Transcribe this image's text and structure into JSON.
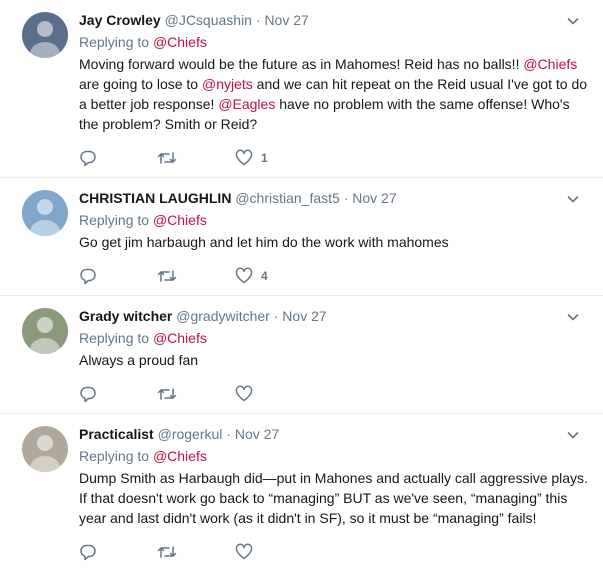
{
  "tweets": [
    {
      "name": "Jay Crowley",
      "handle": "@JCsquashin",
      "sep": "·",
      "time": "Nov 27",
      "replying_prefix": "Replying to ",
      "replying_to": "@Chiefs",
      "segments": [
        {
          "t": "Moving forward would be the future as in Mahomes! Reid has no balls!! ",
          "link": false
        },
        {
          "t": "@Chiefs",
          "link": true
        },
        {
          "t": " are going to lose to ",
          "link": false
        },
        {
          "t": "@nyjets",
          "link": true
        },
        {
          "t": " and we can hit repeat on the Reid usual I've got to do a better job response! ",
          "link": false
        },
        {
          "t": "@Eagles",
          "link": true
        },
        {
          "t": " have no problem with the same offense! Who's the problem? Smith or Reid?",
          "link": false
        }
      ],
      "likes": "1",
      "avatar_color": "#5a6f8a"
    },
    {
      "name": "CHRISTIAN LAUGHLIN",
      "handle": "@christian_fast5",
      "sep": "·",
      "time": "Nov 27",
      "replying_prefix": "Replying to ",
      "replying_to": "@Chiefs",
      "segments": [
        {
          "t": "Go get jim harbaugh and let him do the work with mahomes",
          "link": false
        }
      ],
      "likes": "4",
      "avatar_color": "#7fa7c9"
    },
    {
      "name": "Grady witcher",
      "handle": "@gradywitcher",
      "sep": "·",
      "time": "Nov 27",
      "replying_prefix": "Replying to ",
      "replying_to": "@Chiefs",
      "segments": [
        {
          "t": "Always a proud fan",
          "link": false
        }
      ],
      "likes": "",
      "avatar_color": "#8a9a7a"
    },
    {
      "name": "Practicalist",
      "handle": "@rogerkul",
      "sep": "·",
      "time": "Nov 27",
      "replying_prefix": "Replying to ",
      "replying_to": "@Chiefs",
      "segments": [
        {
          "t": "Dump Smith as Harbaugh did—put in Mahones and actually call aggressive plays. If that doesn't work go back to “managing” BUT as we've seen, “managing” this year and last didn't work (as it didn't in SF), so it must be “managing” fails!",
          "link": false
        }
      ],
      "likes": "",
      "avatar_color": "#b0a89a"
    }
  ],
  "colors": {
    "link": "#c0113f",
    "muted": "#657786",
    "text": "#14171a",
    "border": "#e6ecf0"
  },
  "icons": {
    "reply": "reply-icon",
    "retweet": "retweet-icon",
    "like": "heart-icon",
    "menu": "chevron-down-icon"
  }
}
